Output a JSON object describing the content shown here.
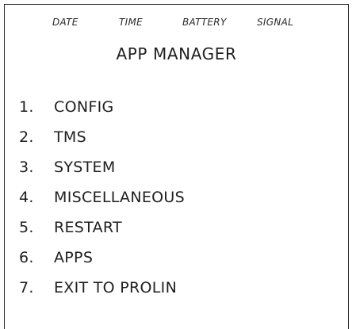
{
  "status_bar": {
    "date": "DATE",
    "time": "TIME",
    "battery": "BATTERY",
    "signal": "SIGNAL"
  },
  "title": "APP MANAGER",
  "menu": {
    "items": [
      {
        "number": "1.",
        "label": "CONFIG"
      },
      {
        "number": "2.",
        "label": "TMS"
      },
      {
        "number": "3.",
        "label": "SYSTEM"
      },
      {
        "number": "4.",
        "label": "MISCELLANEOUS"
      },
      {
        "number": "5.",
        "label": "RESTART"
      },
      {
        "number": "6.",
        "label": "APPS"
      },
      {
        "number": "7.",
        "label": "EXIT TO PROLIN"
      }
    ]
  }
}
